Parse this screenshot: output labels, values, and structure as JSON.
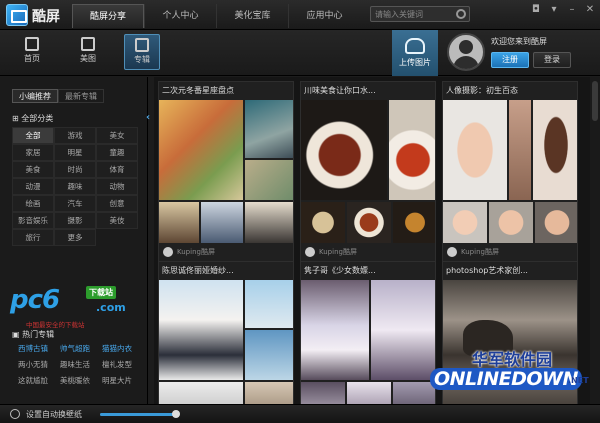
{
  "app": {
    "name": "酷屏"
  },
  "nav": {
    "tabs": [
      {
        "label": "酷屏分享",
        "active": true
      },
      {
        "label": "个人中心",
        "active": false
      },
      {
        "label": "美化宝库",
        "active": false
      },
      {
        "label": "应用中心",
        "active": false
      }
    ]
  },
  "search": {
    "placeholder": "请输入关键词"
  },
  "toolbar": {
    "items": [
      {
        "label": "首页",
        "icon": "star-icon"
      },
      {
        "label": "美图",
        "icon": "image-icon"
      },
      {
        "label": "专辑",
        "icon": "list-icon",
        "active": true
      }
    ],
    "upload_label": "上传图片"
  },
  "user": {
    "welcome": "欢迎您来到酷屏",
    "register_label": "注册",
    "login_label": "登录"
  },
  "sidebar": {
    "tabs": [
      {
        "label": "小编推荐",
        "active": true
      },
      {
        "label": "最新专辑",
        "active": false
      }
    ],
    "category_title": "全部分类",
    "categories": [
      "全部",
      "游戏",
      "美女",
      "家居",
      "明星",
      "童趣",
      "美食",
      "时尚",
      "体育",
      "动漫",
      "趣味",
      "动物",
      "绘画",
      "汽车",
      "创意",
      "影音娱乐",
      "摄影",
      "美伎",
      "旅行",
      "更多"
    ],
    "hot_title": "热门专辑",
    "hot": [
      {
        "label": "西博古镇",
        "hl": true
      },
      {
        "label": "帅气超跑",
        "hl": true
      },
      {
        "label": "猫猫内衣",
        "hl": true
      },
      {
        "label": "两小无猜",
        "hl": false
      },
      {
        "label": "趣味生活",
        "hl": false
      },
      {
        "label": "檀礼发型",
        "hl": false
      },
      {
        "label": "这就尴尬",
        "hl": false
      },
      {
        "label": "美桃暖依",
        "hl": false
      },
      {
        "label": "明星大片",
        "hl": false
      }
    ]
  },
  "ad": {
    "logo_text": "pc6",
    "badge": "下载站",
    "domain": ".com",
    "tagline": "中国最安全的下载站"
  },
  "cards": [
    {
      "title": "二次元冬番星座盘点",
      "author": "Kuping酷屏"
    },
    {
      "title": "川味美食让你口水...",
      "author": "Kuping酷屏"
    },
    {
      "title": "人像摄影：初生百态",
      "author": "Kuping酷屏"
    },
    {
      "title": "陈思诚佟丽娅婚纱...",
      "author": ""
    },
    {
      "title": "隽子哥《少女数嫖...",
      "author": ""
    },
    {
      "title": "photoshop艺术家创...",
      "author": ""
    }
  ],
  "status": {
    "auto_wallpaper_label": "设置自动换壁纸",
    "slider_value": 0.95
  },
  "watermark": {
    "cn": "华军软件园",
    "en": "ONLINEDOWN",
    "net": ".NET"
  },
  "colors": {
    "accent": "#2f8fd6",
    "hot_highlight": "#48a6e8"
  }
}
